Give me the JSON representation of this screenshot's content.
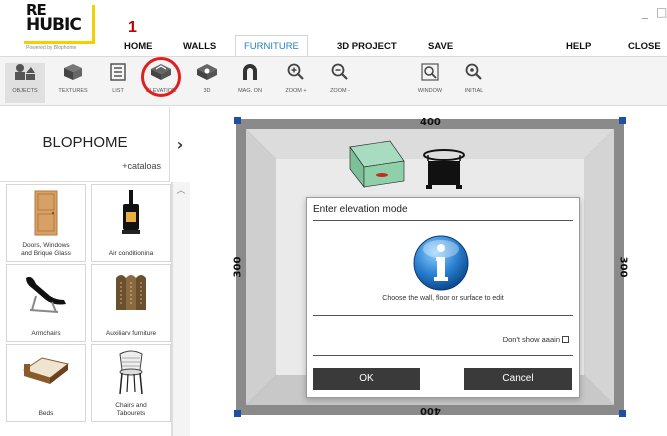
{
  "logo": {
    "line1": "RE",
    "line2": "HUBIC",
    "tagline": "Powered by Blophome"
  },
  "annotation": {
    "step_number": "1"
  },
  "menu": {
    "home": "HOME",
    "walls": "WALLS",
    "furniture": "FURNITURE",
    "project3d": "3D PROJECT",
    "save": "SAVE",
    "help": "HELP",
    "close": "CLOSE"
  },
  "window_controls": {
    "minimize": "_",
    "maximize": "□"
  },
  "toolbar": {
    "objects": "OBJECTS",
    "textures": "TEXTURES",
    "list": "LIST",
    "elevation": "ELEVATION",
    "view3d": "3D",
    "magnet": "MAG. ON",
    "zoom_in": "ZOOM +",
    "zoom_out": "ZOOM -",
    "window": "WINDOW",
    "initial": "INITIAL"
  },
  "catalog": {
    "name": "BLOPHOME",
    "link": "+cataloas",
    "next_arrow": "›"
  },
  "categories": [
    {
      "label": "Doors, Windows\nand Brique Glass",
      "icon": "door-icon"
    },
    {
      "label": "Air conditionina",
      "icon": "stove-icon"
    },
    {
      "label": "Armchairs",
      "icon": "lounge-chair-icon"
    },
    {
      "label": "Auxiliarv furniture",
      "icon": "screen-icon"
    },
    {
      "label": "Beds",
      "icon": "bed-icon"
    },
    {
      "label": "Chairs and\nTabourets",
      "icon": "chair-icon"
    }
  ],
  "room": {
    "width_label": "400",
    "height_label": "300"
  },
  "dialog": {
    "title": "Enter elevation mode",
    "message": "Choose the wall, floor or surface to edit",
    "checkbox_label": "Don't show aaain",
    "ok": "OK",
    "cancel": "Cancel"
  },
  "colors": {
    "accent": "#2a7fc1",
    "highlight_ring": "#e02020",
    "logo_yellow": "#f4d000",
    "room_wall": "#8a8a8a",
    "button": "#3a3a3a"
  }
}
